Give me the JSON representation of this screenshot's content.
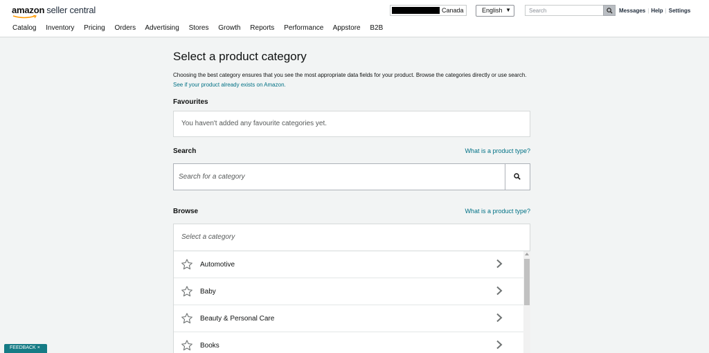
{
  "header": {
    "logo_brand": "amazon",
    "logo_product": "seller central",
    "marketplace": "Canada",
    "language": "English",
    "search_placeholder": "Search",
    "links": [
      "Messages",
      "Help",
      "Settings"
    ]
  },
  "nav": {
    "items": [
      "Catalog",
      "Inventory",
      "Pricing",
      "Orders",
      "Advertising",
      "Stores",
      "Growth",
      "Reports",
      "Performance",
      "Appstore",
      "B2B"
    ]
  },
  "main": {
    "title": "Select a product category",
    "description": "Choosing the best category ensures that you see the most appropriate data fields for your product. Browse the categories directly or use search.",
    "description_link": "See if your product already exists on Amazon.",
    "favourites": {
      "heading": "Favourites",
      "empty_text": "You haven't added any favourite categories yet."
    },
    "search": {
      "heading": "Search",
      "help_link": "What is a product type?",
      "placeholder": "Search for a category"
    },
    "browse": {
      "heading": "Browse",
      "help_link": "What is a product type?",
      "placeholder": "Select a category",
      "categories": [
        {
          "label": "Automotive"
        },
        {
          "label": "Baby"
        },
        {
          "label": "Beauty & Personal Care"
        },
        {
          "label": "Books"
        }
      ]
    }
  },
  "feedback": {
    "label": "FEEDBACK",
    "close": "×"
  },
  "colors": {
    "link": "#007185",
    "background": "#f2f4f4",
    "feedback_bg": "#157b85"
  },
  "icons": [
    "search-icon",
    "star-icon",
    "chevron-right-icon",
    "chevron-down-icon",
    "close-icon"
  ]
}
